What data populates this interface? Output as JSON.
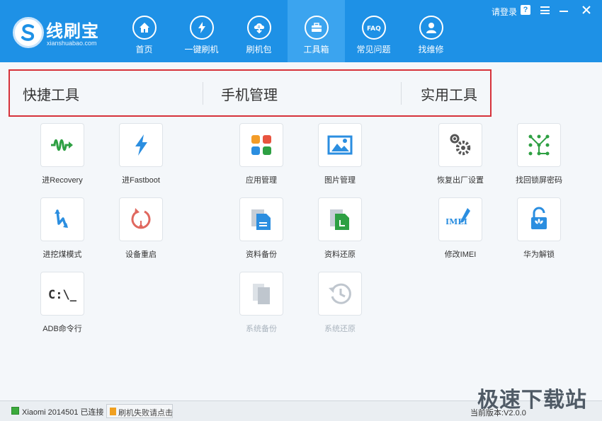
{
  "app": {
    "name": "线刷宝",
    "domain": "xianshuabao.com"
  },
  "nav": {
    "items": [
      {
        "label": "首页",
        "icon": "home-icon"
      },
      {
        "label": "一键刷机",
        "icon": "flash-icon"
      },
      {
        "label": "刷机包",
        "icon": "rom-package-icon"
      },
      {
        "label": "工具箱",
        "icon": "toolbox-icon"
      },
      {
        "label": "常见问题",
        "icon": "faq-icon"
      },
      {
        "label": "找维修",
        "icon": "repair-icon"
      }
    ],
    "faq_glyph": "FAQ",
    "active_index": 3
  },
  "window": {
    "login": "请登录",
    "help": "?"
  },
  "tabs": [
    "快捷工具",
    "手机管理",
    "实用工具"
  ],
  "tools": {
    "quick": [
      {
        "label": "进Recovery",
        "icon": "recovery-icon"
      },
      {
        "label": "进Fastboot",
        "icon": "fastboot-icon"
      },
      {
        "label": "进挖煤模式",
        "icon": "download-mode-icon"
      },
      {
        "label": "设备重启",
        "icon": "reboot-icon"
      },
      {
        "label": "ADB命令行",
        "icon": "terminal-icon",
        "glyph": "C:\\_"
      }
    ],
    "manage": [
      {
        "label": "应用管理",
        "icon": "app-manage-icon"
      },
      {
        "label": "图片管理",
        "icon": "image-manage-icon"
      },
      {
        "label": "资料备份",
        "icon": "data-backup-icon"
      },
      {
        "label": "资料还原",
        "icon": "data-restore-icon"
      },
      {
        "label": "系统备份",
        "icon": "system-backup-icon",
        "disabled": true
      },
      {
        "label": "系统还原",
        "icon": "system-restore-icon",
        "disabled": true
      }
    ],
    "utility": [
      {
        "label": "恢复出厂设置",
        "icon": "factory-reset-icon"
      },
      {
        "label": "找回锁屏密码",
        "icon": "pattern-lock-icon"
      },
      {
        "label": "修改IMEI",
        "icon": "edit-imei-icon",
        "glyph": "IMEI"
      },
      {
        "label": "华为解锁",
        "icon": "huawei-unlock-icon"
      }
    ]
  },
  "status": {
    "device": "Xiaomi 2014501 已连接",
    "fail_button": "刷机失败请点击",
    "version": "当前版本:V2.0.0"
  },
  "watermark": "极速下载站",
  "colors": {
    "topbar": "#1e91e6",
    "highlight_border": "#d6323a",
    "recovery_green": "#2ea043",
    "blue": "#2b8ee0"
  }
}
